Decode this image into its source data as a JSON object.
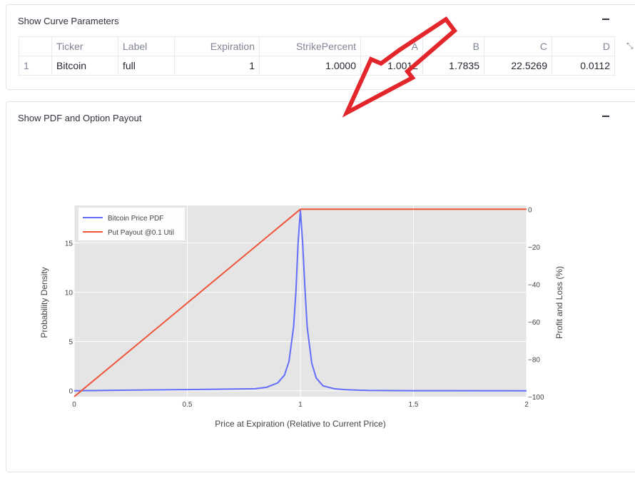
{
  "curve_params": {
    "title": "Show Curve Parameters",
    "columns": [
      "",
      "Ticker",
      "Label",
      "Expiration",
      "StrikePercent",
      "A",
      "B",
      "C",
      "D"
    ],
    "rows": [
      [
        "1",
        "Bitcoin",
        "full",
        "1",
        "1.0000",
        "1.0012",
        "1.7835",
        "22.5269",
        "0.0112"
      ]
    ]
  },
  "pdf_section": {
    "title": "Show PDF and Option Payout"
  },
  "annotation": {
    "arrow_color": "#e3262b"
  },
  "chart_data": {
    "type": "line",
    "xlabel": "Price at Expiration (Relative to Current Price)",
    "ylabel": "Probability Density",
    "y2label": "Profit and Loss (%)",
    "xlim": [
      0,
      2
    ],
    "ylim": [
      -0.6,
      18.8
    ],
    "y2lim": [
      -100,
      2
    ],
    "x_ticks": [
      "0",
      "0.5",
      "1",
      "1.5",
      "2"
    ],
    "y_ticks": [
      "0",
      "5",
      "10",
      "15"
    ],
    "y2_ticks": [
      "0",
      "−20",
      "−40",
      "−60",
      "−80",
      "−100"
    ],
    "legend_position": "top-left",
    "grid": true,
    "series": [
      {
        "name": "Bitcoin Price PDF",
        "axis": "y",
        "color": "#636efa",
        "x": [
          0,
          0.2,
          0.5,
          0.8,
          0.85,
          0.9,
          0.93,
          0.95,
          0.97,
          0.98,
          0.99,
          1.0,
          1.01,
          1.02,
          1.03,
          1.05,
          1.07,
          1.1,
          1.15,
          1.2,
          1.3,
          1.5,
          2.0
        ],
        "values": [
          0,
          0.05,
          0.12,
          0.2,
          0.35,
          0.8,
          1.6,
          3.0,
          6.5,
          10.0,
          15.0,
          18.3,
          15.0,
          10.5,
          6.5,
          2.8,
          1.3,
          0.5,
          0.2,
          0.1,
          0.03,
          0.01,
          0
        ]
      },
      {
        "name": "Put Payout @0.1 Util",
        "axis": "y2",
        "color": "#ef553b",
        "x": [
          0,
          1,
          2
        ],
        "values": [
          -100,
          0,
          0
        ]
      }
    ]
  }
}
